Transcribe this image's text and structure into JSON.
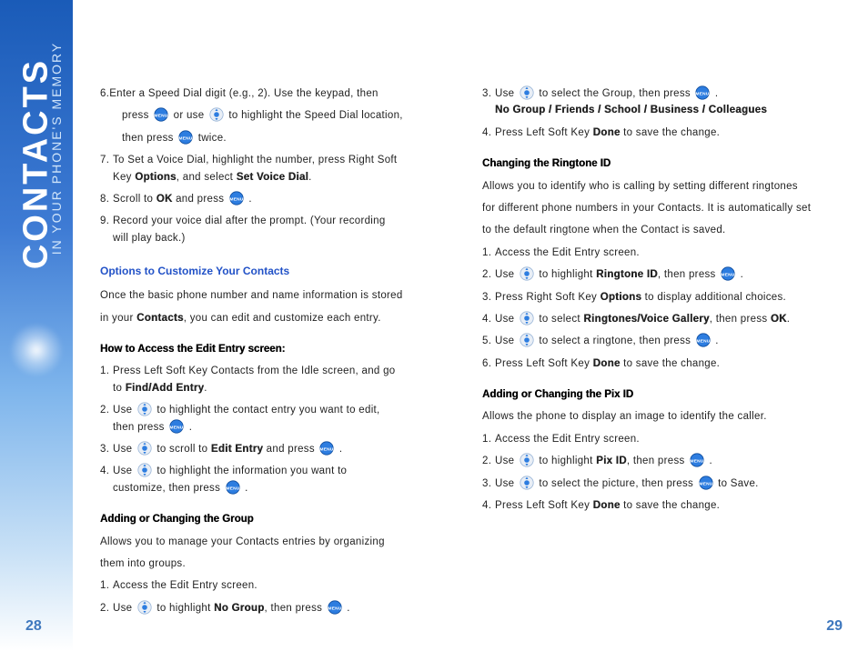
{
  "sidebar": {
    "title": "CONTACTS",
    "subtitle": "IN YOUR PHONE'S MEMORY"
  },
  "pageNumbers": {
    "left": "28",
    "right": "29"
  },
  "icons": {
    "menu": "menu-ok-icon",
    "nav": "nav-arrows-icon"
  },
  "left": {
    "step6a": "6.Enter a Speed Dial digit (e.g., 2). Use the keypad, then",
    "step6b_1": "press ",
    "step6b_2": " or use ",
    "step6b_3": " to highlight the Speed Dial location,",
    "step6c_1": "then press ",
    "step6c_2": " twice.",
    "step7_num": "7.",
    "step7a": "To Set a Voice Dial, highlight the number, press Right Soft",
    "step7b_1": "Key ",
    "step7b_opt": "Options",
    "step7b_2": ", and select ",
    "step7b_svd": "Set Voice Dial",
    "step7b_3": ".",
    "step8_num": "8.",
    "step8_1": "Scroll to ",
    "step8_ok": "OK",
    "step8_2": " and press ",
    "step8_3": ".",
    "step9_num": "9.",
    "step9a": "Record your voice dial after the prompt. (Your recording",
    "step9b": "will play back.)",
    "sec1": "Options to Customize Your Contacts",
    "sec1p1": "Once the basic phone number and name information is stored",
    "sec1p2_1": "in your ",
    "sec1p2_b": "Contacts",
    "sec1p2_2": ", you can edit and customize each entry.",
    "sub1": "How to Access the Edit Entry screen:",
    "s1_num": "1.",
    "s1a": "Press Left Soft Key Contacts from the Idle screen, and go",
    "s1b_1": "to ",
    "s1b_b": "Find/Add Entry",
    "s1b_2": ".",
    "s2_num": "2.",
    "s2_1": "Use ",
    "s2_2": " to highlight the contact entry you want to edit,",
    "s2b_1": "then press ",
    "s2b_2": ".",
    "s3_num": "3.",
    "s3_1": "Use ",
    "s3_2": " to scroll to ",
    "s3_b": "Edit Entry",
    "s3_3": " and press ",
    "s3_4": ".",
    "s4_num": "4.",
    "s4_1": "Use ",
    "s4_2": " to highlight the information you want to",
    "s4b_1": "customize, then press ",
    "s4b_2": ".",
    "sub2": "Adding or Changing the Group",
    "sub2p1": "Allows you to manage your Contacts entries by organizing",
    "sub2p2": "them into groups.",
    "g1_num": "1.",
    "g1": "Access the Edit Entry screen.",
    "g2_num": "2.",
    "g2_1": "Use ",
    "g2_2": " to highlight ",
    "g2_b": "No Group",
    "g2_3": ", then press ",
    "g2_4": "."
  },
  "right": {
    "r3_num": "3.",
    "r3_1": "Use ",
    "r3_2": " to select the Group, then press ",
    "r3_3": ".",
    "r3b": "No Group / Friends / School / Business / Colleagues",
    "r4_num": "4.",
    "r4_1": "Press Left Soft Key ",
    "r4_b": "Done",
    "r4_2": " to save the change.",
    "subA": "Changing the Ringtone ID",
    "subAp1": "Allows you to identify who is calling by setting different ringtones",
    "subAp2": "for different phone numbers in your Contacts. It is automatically set",
    "subAp3": "to the default ringtone when the Contact is saved.",
    "a1_num": "1.",
    "a1": "Access the Edit Entry screen.",
    "a2_num": "2.",
    "a2_1": "Use ",
    "a2_2": " to highlight ",
    "a2_b": "Ringtone ID",
    "a2_3": ", then press ",
    "a2_4": ".",
    "a3_num": "3.",
    "a3_1": "Press Right Soft Key ",
    "a3_b": "Options",
    "a3_2": " to display additional choices.",
    "a4_num": "4.",
    "a4_1": "Use ",
    "a4_2": " to select ",
    "a4_b": "Ringtones/Voice Gallery",
    "a4_3": ", then press ",
    "a4_ok": "OK",
    "a4_4": ".",
    "a5_num": "5.",
    "a5_1": "Use ",
    "a5_2": " to select a ringtone, then press ",
    "a5_3": ".",
    "a6_num": "6.",
    "a6_1": "Press Left Soft Key ",
    "a6_b": "Done",
    "a6_2": " to save the change.",
    "subB": "Adding or Changing the Pix ID",
    "subBp": "Allows the phone to display an image to identify the caller.",
    "b1_num": "1.",
    "b1": "Access the Edit Entry screen.",
    "b2_num": "2.",
    "b2_1": "Use ",
    "b2_2": " to highlight ",
    "b2_b": "Pix ID",
    "b2_3": ", then press ",
    "b2_4": ".",
    "b3_num": "3.",
    "b3_1": "Use ",
    "b3_2": " to select the picture, then press ",
    "b3_3": " to Save.",
    "b4_num": "4.",
    "b4_1": "Press Left Soft Key ",
    "b4_b": "Done",
    "b4_2": " to save the change."
  }
}
